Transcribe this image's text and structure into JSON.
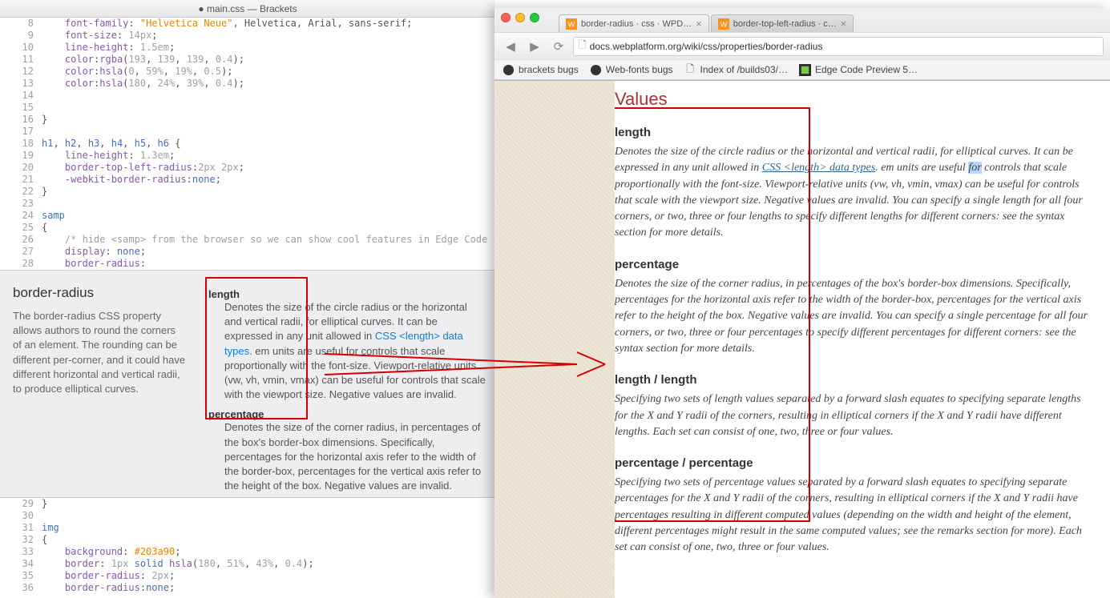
{
  "editor": {
    "title": "● main.css — Brackets",
    "lines": [
      {
        "n": 8,
        "html": "    <span class='tok-prop'>font-family</span>: <span class='tok-str'>\"Helvetica Neue\"</span>, Helvetica, Arial, sans-serif;"
      },
      {
        "n": 9,
        "html": "    <span class='tok-prop'>font-size</span>: <span class='tok-num'>14px</span>;"
      },
      {
        "n": 10,
        "html": "    <span class='tok-prop'>line-height</span>: <span class='tok-num'>1.5em</span>;"
      },
      {
        "n": 11,
        "html": "    <span class='tok-prop'>color</span>:<span class='tok-fn'>rgba</span>(<span class='tok-num'>193</span>, <span class='tok-num'>139</span>, <span class='tok-num'>139</span>, <span class='tok-num'>0.4</span>);"
      },
      {
        "n": 12,
        "html": "    <span class='tok-prop'>color</span>:<span class='tok-fn'>hsla</span>(<span class='tok-num'>0</span>, <span class='tok-num'>59%</span>, <span class='tok-num'>19%</span>, <span class='tok-num'>0.5</span>);"
      },
      {
        "n": 13,
        "html": "    <span class='tok-prop'>color</span>:<span class='tok-fn'>hsla</span>(<span class='tok-num'>180</span>, <span class='tok-num'>24%</span>, <span class='tok-num'>39%</span>, <span class='tok-num'>0.4</span>);"
      },
      {
        "n": 14,
        "html": ""
      },
      {
        "n": 15,
        "html": ""
      },
      {
        "n": 16,
        "html": "}"
      },
      {
        "n": 17,
        "html": ""
      },
      {
        "n": 18,
        "html": "<span class='tok-sel'>h1</span>, <span class='tok-sel'>h2</span>, <span class='tok-sel'>h3</span>, <span class='tok-sel'>h4</span>, <span class='tok-sel'>h5</span>, <span class='tok-sel'>h6</span> {"
      },
      {
        "n": 19,
        "html": "    <span class='tok-prop'>line-height</span>: <span class='tok-num'>1.3em</span>;"
      },
      {
        "n": 20,
        "html": "    <span class='tok-prop'>border-top-left-radius</span>:<span class='tok-num'>2px</span> <span class='tok-num'>2px</span>;"
      },
      {
        "n": 21,
        "html": "    <span class='tok-prop'>-webkit-border-radius</span>:<span class='tok-kw'>none</span>;"
      },
      {
        "n": 22,
        "html": "}"
      },
      {
        "n": 23,
        "html": ""
      },
      {
        "n": 24,
        "html": "<span class='tok-sel'>samp</span>"
      },
      {
        "n": 25,
        "html": "{"
      },
      {
        "n": 26,
        "html": "    <span class='tok-num'>/* hide &lt;samp&gt; from the browser so we can show cool features in Edge Code</span>"
      },
      {
        "n": 27,
        "html": "    <span class='tok-prop'>display</span>: <span class='tok-kw'>none</span>;"
      },
      {
        "n": 28,
        "html": "    <span class='tok-prop'>border-radius</span>:"
      }
    ],
    "lines2": [
      {
        "n": 29,
        "html": "}"
      },
      {
        "n": 30,
        "html": ""
      },
      {
        "n": 31,
        "html": "<span class='tok-sel'>img</span>"
      },
      {
        "n": 32,
        "html": "{"
      },
      {
        "n": 33,
        "html": "    <span class='tok-prop'>background</span>: <span class='tok-str'>#203a90</span>;"
      },
      {
        "n": 34,
        "html": "    <span class='tok-prop'>border</span>: <span class='tok-num'>1px</span> <span class='tok-kw'>solid</span> <span class='tok-fn'>hsla</span>(<span class='tok-num'>180</span>, <span class='tok-num'>51%</span>, <span class='tok-num'>43%</span>, <span class='tok-num'>0.4</span>);"
      },
      {
        "n": 35,
        "html": "    <span class='tok-prop'>border-radius</span>: <span class='tok-num'>2px</span>;"
      },
      {
        "n": 36,
        "html": "    <span class='tok-prop'>border-radius</span>:<span class='tok-kw'>none</span>;"
      }
    ]
  },
  "inline_docs": {
    "title": "border-radius",
    "summary": "The border-radius CSS property allows authors to round the corners of an element. The rounding can be different per-corner, and it could have different horizontal and vertical radii, to produce elliptical curves.",
    "values": [
      {
        "term": "length",
        "desc_html": "Denotes the size of the circle radius or the horizontal and vertical radii, for elliptical curves. It can be expressed in any unit allowed in <a href='#'>CSS &lt;length&gt; data types</a>. em units are useful for controls that scale proportionally with the font-size. Viewport-relative units (vw, vh, vmin, vmax) can be useful for controls that scale with the viewport size. Negative values are invalid."
      },
      {
        "term": "percentage",
        "desc_html": "Denotes the size of the corner radius, in percentages of the box's border-box dimensions. Specifically, percentages for the horizontal axis refer to the width of the border-box, percentages for the vertical axis refer to the height of the box. Negative values are invalid."
      }
    ]
  },
  "browser": {
    "tabs": [
      {
        "label": "border-radius · css · WPD…",
        "active": true
      },
      {
        "label": "border-top-left-radius · c…",
        "active": false
      }
    ],
    "url": "docs.webplatform.org/wiki/css/properties/border-radius",
    "bookmarks": [
      {
        "icon": "github",
        "label": "brackets bugs"
      },
      {
        "icon": "github",
        "label": "Web-fonts bugs"
      },
      {
        "icon": "file",
        "label": "Index of /builds03/…"
      },
      {
        "icon": "edge",
        "label": "Edge Code Preview 5…"
      }
    ],
    "page": {
      "heading": "Values",
      "sections": [
        {
          "title": "length",
          "body_html": "Denotes the size of the circle radius or the horizontal and vertical radii, for elliptical curves. It can be expressed in any unit allowed in <a href='#'>CSS &lt;length&gt; data types</a>. em units are useful <span class='hl'>for</span> controls that scale proportionally with the font-size. Viewport-relative units (vw, vh, vmin, vmax) can be useful for controls that scale with the viewport size. Negative values are invalid. You can specify a single length for all four corners, or two, three or four lengths to specify different lengths for different corners: see the syntax section for more details."
        },
        {
          "title": "percentage",
          "body_html": "Denotes the size of the corner radius, in percentages of the box's border-box dimensions. Specifically, percentages for the horizontal axis refer to the width of the border-box, percentages for the vertical axis refer to the height of the box. Negative values are invalid. You can specify a single percentage for all four corners, or two, three or four percentages to specify different percentages for different corners: see the syntax section for more details."
        },
        {
          "title": "length / length",
          "body_html": "Specifying two sets of length values separated by a forward slash equates to specifying separate lengths for the X and Y radii of the corners, resulting in elliptical corners if the X and Y radii have different lengths. Each set can consist of one, two, three or four values."
        },
        {
          "title": "percentage / percentage",
          "body_html": "Specifying two sets of percentage values separated by a forward slash equates to specifying separate percentages for the X and Y radii of the corners, resulting in elliptical corners if the X and Y radii have percentages resulting in different computed values (depending on the width and height of the element, different percentages might result in the same computed values; see the remarks section for more). Each set can consist of one, two, three or four values."
        }
      ]
    }
  }
}
